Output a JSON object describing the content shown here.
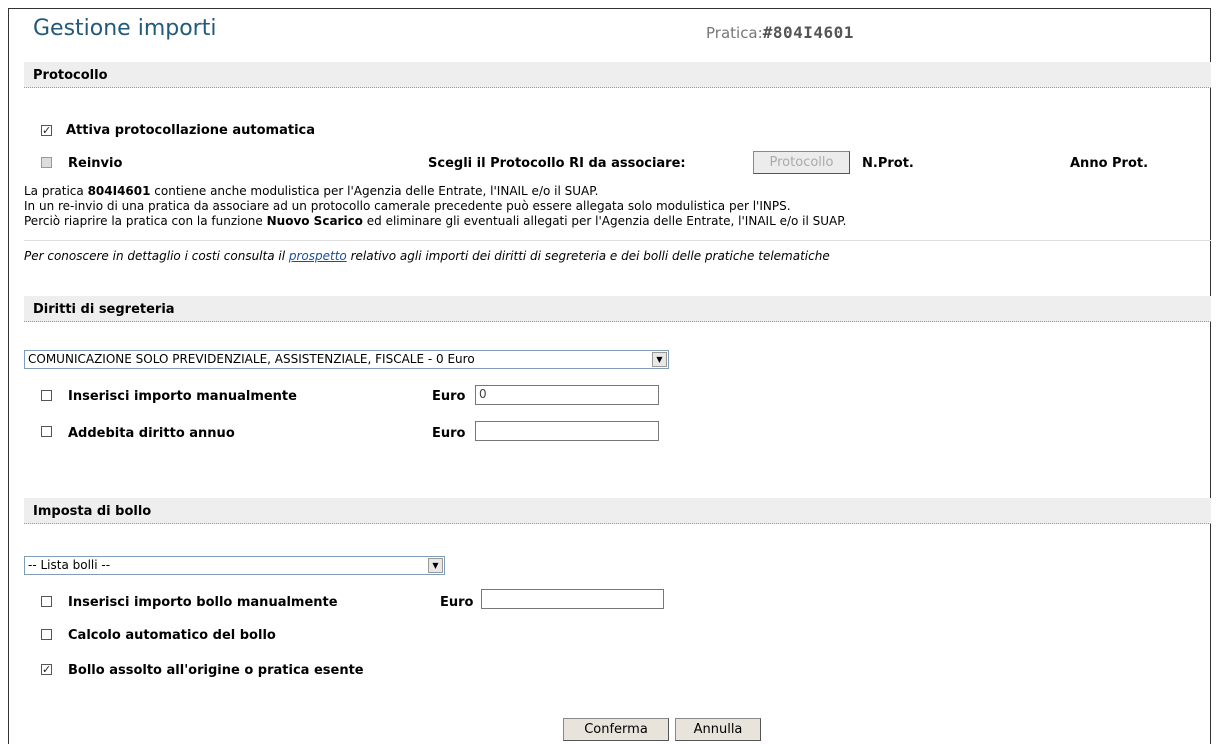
{
  "header": {
    "title": "Gestione importi",
    "pratica_label": "Pratica:",
    "pratica_value": "#804I4601"
  },
  "protocollo": {
    "section_title": "Protocollo",
    "attiva_label": "Attiva protocollazione automatica",
    "reinvio_label": "Reinvio",
    "scegli_label": "Scegli il Protocollo RI da associare:",
    "protocollo_button": "Protocollo",
    "nprot_label": "N.Prot.",
    "annoprot_label": "Anno Prot.",
    "info1_pre": "La pratica ",
    "info1_code": "804I4601",
    "info1_post": " contiene anche modulistica per l'Agenzia delle Entrate, l'INAIL e/o il SUAP.",
    "info2": "In un re-invio di una pratica da associare ad un protocollo camerale precedente può essere allegata solo modulistica per l'INPS.",
    "info3_pre": "Perciò riaprire la pratica con la funzione ",
    "info3_bold": "Nuovo Scarico",
    "info3_post": " ed eliminare gli eventuali allegati per l'Agenzia delle Entrate, l'INAIL e/o il SUAP.",
    "costi_pre": "Per conoscere in dettaglio i costi consulta il ",
    "costi_link": "prospetto",
    "costi_post": " relativo agli importi dei diritti di segreteria e dei bolli delle pratiche telematiche"
  },
  "diritti": {
    "section_title": "Diritti di segreteria",
    "select_value": "COMUNICAZIONE SOLO PREVIDENZIALE, ASSISTENZIALE, FISCALE - 0 Euro",
    "manuale_label": "Inserisci importo manualmente",
    "euro_label": "Euro",
    "manuale_value": "0",
    "annuo_label": "Addebita diritto annuo",
    "annuo_value": ""
  },
  "bollo": {
    "section_title": "Imposta di bollo",
    "select_value": "-- Lista bolli --",
    "manuale_label": "Inserisci importo bollo manualmente",
    "euro_label": "Euro",
    "manuale_value": "",
    "calcolo_label": "Calcolo automatico del bollo",
    "assolto_label": "Bollo assolto all'origine o pratica esente"
  },
  "actions": {
    "confirm": "Conferma",
    "cancel": "Annulla"
  },
  "icons": {
    "check": "✓",
    "dropdown": "▼"
  }
}
